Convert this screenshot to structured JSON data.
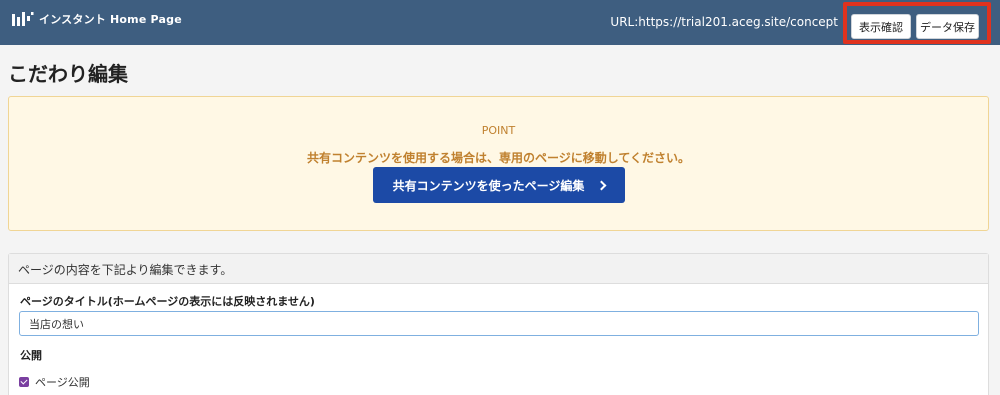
{
  "header": {
    "logo_text": "インスタント Home Page",
    "url": "URL:https://trial201.aceg.site/concept",
    "preview_label": "表示確認",
    "save_label": "データ保存"
  },
  "page_title": "こだわり編集",
  "point_box": {
    "label": "POINT",
    "message": "共有コンテンツを使用する場合は、専用のページに移動してください。",
    "button_label": "共有コンテンツを使ったページ編集"
  },
  "edit_panel": {
    "heading": "ページの内容を下記より編集できます。",
    "title_label": "ページのタイトル(ホームページの表示には反映されません)",
    "title_value": "当店の想い",
    "publish_label": "公開",
    "publish_checkbox_label": "ページ公開",
    "publish_checked": true
  },
  "colors": {
    "header_bg": "#3e5e80",
    "highlight_border": "#e0321e",
    "point_text": "#c0812f",
    "primary_button": "#1c4aa6",
    "checkbox": "#7a3fa0"
  },
  "icons": [
    "logo-icon",
    "chevron-right-icon",
    "checkmark-icon"
  ]
}
